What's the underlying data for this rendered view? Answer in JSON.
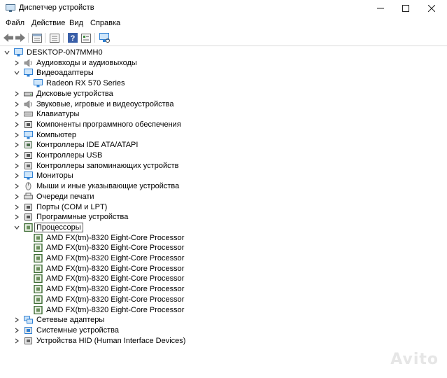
{
  "window": {
    "title": "Диспетчер устройств"
  },
  "menu": [
    "Файл",
    "Действие",
    "Вид",
    "Справка"
  ],
  "toolbar": {
    "icons": [
      "back-arrow-icon",
      "forward-arrow-icon",
      "properties-icon",
      "list-view-icon",
      "help-icon",
      "resources-view-icon",
      "monitor-scan-icon"
    ]
  },
  "tree": {
    "root": "DESKTOP-0N7MMH0",
    "categories": [
      {
        "label": "Аудиовходы и аудиовыходы",
        "icon": "speaker-icon",
        "expanded": false
      },
      {
        "label": "Видеоадаптеры",
        "icon": "display-adapter-icon",
        "expanded": true,
        "children": [
          "Radeon RX 570 Series"
        ]
      },
      {
        "label": "Дисковые устройства",
        "icon": "disk-drive-icon",
        "expanded": false
      },
      {
        "label": "Звуковые, игровые и видеоустройства",
        "icon": "sound-icon",
        "expanded": false
      },
      {
        "label": "Клавиатуры",
        "icon": "keyboard-icon",
        "expanded": false
      },
      {
        "label": "Компоненты программного обеспечения",
        "icon": "software-component-icon",
        "expanded": false
      },
      {
        "label": "Компьютер",
        "icon": "computer-icon",
        "expanded": false
      },
      {
        "label": "Контроллеры IDE ATA/ATAPI",
        "icon": "ide-controller-icon",
        "expanded": false
      },
      {
        "label": "Контроллеры USB",
        "icon": "usb-icon",
        "expanded": false
      },
      {
        "label": "Контроллеры запоминающих устройств",
        "icon": "storage-controller-icon",
        "expanded": false
      },
      {
        "label": "Мониторы",
        "icon": "monitor-icon",
        "expanded": false
      },
      {
        "label": "Мыши и иные указывающие устройства",
        "icon": "mouse-icon",
        "expanded": false
      },
      {
        "label": "Очереди печати",
        "icon": "printer-icon",
        "expanded": false
      },
      {
        "label": "Порты (COM и LPT)",
        "icon": "port-icon",
        "expanded": false
      },
      {
        "label": "Программные устройства",
        "icon": "software-device-icon",
        "expanded": false
      },
      {
        "label": "Процессоры",
        "icon": "processor-icon",
        "expanded": true,
        "selected": true,
        "children": [
          "AMD FX(tm)-8320 Eight-Core Processor",
          "AMD FX(tm)-8320 Eight-Core Processor",
          "AMD FX(tm)-8320 Eight-Core Processor",
          "AMD FX(tm)-8320 Eight-Core Processor",
          "AMD FX(tm)-8320 Eight-Core Processor",
          "AMD FX(tm)-8320 Eight-Core Processor",
          "AMD FX(tm)-8320 Eight-Core Processor",
          "AMD FX(tm)-8320 Eight-Core Processor"
        ]
      },
      {
        "label": "Сетевые адаптеры",
        "icon": "network-adapter-icon",
        "expanded": false
      },
      {
        "label": "Системные устройства",
        "icon": "system-device-icon",
        "expanded": false
      },
      {
        "label": "Устройства HID (Human Interface Devices)",
        "icon": "hid-icon",
        "expanded": false
      }
    ]
  },
  "watermark": "Avito",
  "colors": {
    "selection_outline": "#5a5a5a",
    "cpu_green": "#3c6b32",
    "monitor_blue": "#2d7fd3"
  }
}
